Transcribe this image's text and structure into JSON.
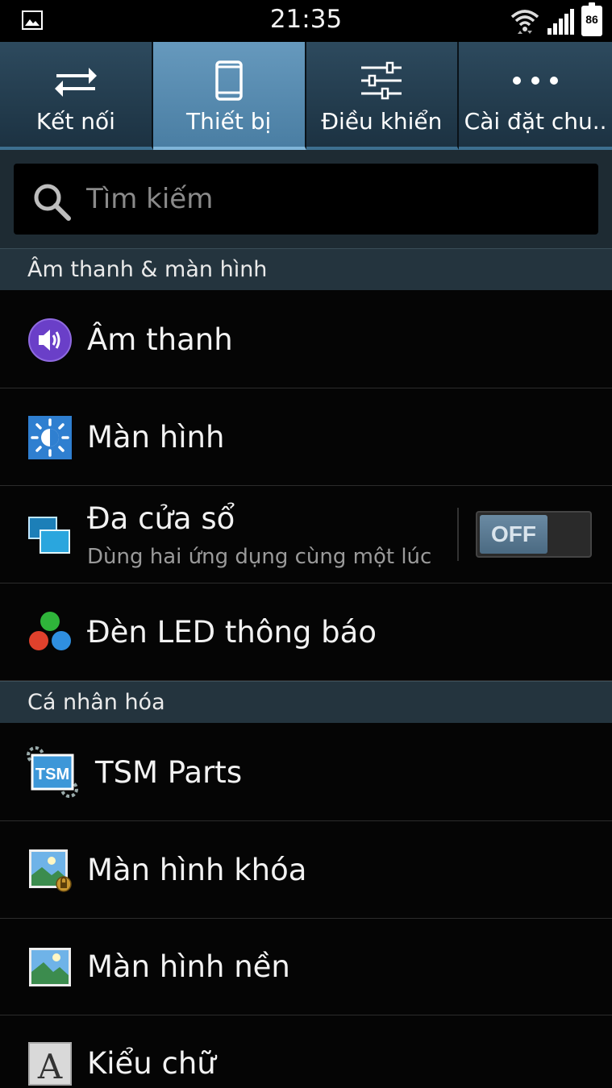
{
  "status_bar": {
    "time": "21:35",
    "battery_level": "86",
    "icons": [
      "gallery-icon",
      "wifi-icon",
      "signal-icon",
      "battery-icon"
    ]
  },
  "tabs": [
    {
      "label": "Kết nối",
      "icon": "swap-arrows-icon",
      "active": false
    },
    {
      "label": "Thiết bị",
      "icon": "phone-icon",
      "active": true
    },
    {
      "label": "Điều khiển",
      "icon": "sliders-icon",
      "active": false
    },
    {
      "label": "Cài đặt chu..",
      "icon": "more-dots-icon",
      "active": false
    }
  ],
  "search": {
    "placeholder": "Tìm kiếm"
  },
  "sections": [
    {
      "title": "Âm thanh & màn hình",
      "items": [
        {
          "title": "Âm thanh",
          "icon": "speaker-icon"
        },
        {
          "title": "Màn hình",
          "icon": "brightness-icon"
        },
        {
          "title": "Đa cửa sổ",
          "subtitle": "Dùng hai ứng dụng cùng một lúc",
          "icon": "multi-window-icon",
          "toggle": "OFF"
        },
        {
          "title": "Đèn LED thông báo",
          "icon": "led-dots-icon"
        }
      ]
    },
    {
      "title": "Cá nhân hóa",
      "items": [
        {
          "title": "TSM Parts",
          "icon": "tsm-icon",
          "icon_text": "TSM"
        },
        {
          "title": "Màn hình khóa",
          "icon": "lockscreen-icon"
        },
        {
          "title": "Màn hình nền",
          "icon": "wallpaper-icon"
        },
        {
          "title": "Kiểu chữ",
          "icon": "font-icon",
          "icon_text": "A"
        }
      ]
    }
  ],
  "colors": {
    "tab_active": "#5a8db2",
    "tab_inactive": "#25404f",
    "section_header_bg": "#24343e",
    "speaker_purple": "#6a3fc8",
    "brightness_blue": "#2f7fd0"
  }
}
